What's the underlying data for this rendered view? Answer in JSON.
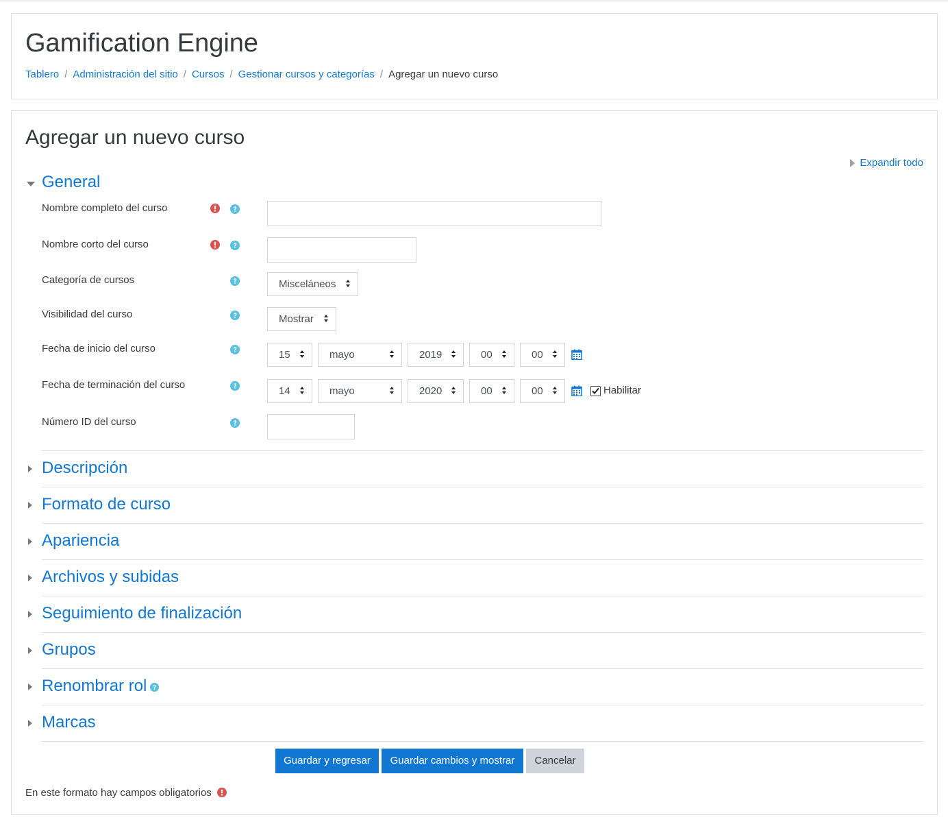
{
  "site": {
    "title": "Gamification Engine"
  },
  "breadcrumb": [
    {
      "label": "Tablero"
    },
    {
      "label": "Administración del sitio"
    },
    {
      "label": "Cursos"
    },
    {
      "label": "Gestionar cursos y categorías"
    },
    {
      "label": "Agregar un nuevo curso"
    }
  ],
  "page": {
    "heading": "Agregar un nuevo curso",
    "expand_all": "Expandir todo"
  },
  "general": {
    "title": "General",
    "fields": {
      "fullname": {
        "label": "Nombre completo del curso",
        "value": ""
      },
      "shortname": {
        "label": "Nombre corto del curso",
        "value": ""
      },
      "category": {
        "label": "Categoría de cursos",
        "value": "Misceláneos"
      },
      "visibility": {
        "label": "Visibilidad del curso",
        "value": "Mostrar"
      },
      "startdate": {
        "label": "Fecha de inicio del curso",
        "day": "15",
        "month": "mayo",
        "year": "2019",
        "hour": "00",
        "minute": "00"
      },
      "enddate": {
        "label": "Fecha de terminación del curso",
        "day": "14",
        "month": "mayo",
        "year": "2020",
        "hour": "00",
        "minute": "00",
        "enable_label": "Habilitar",
        "enabled": true
      },
      "idnumber": {
        "label": "Número ID del curso",
        "value": ""
      }
    }
  },
  "sections": [
    {
      "title": "Descripción"
    },
    {
      "title": "Formato de curso"
    },
    {
      "title": "Apariencia"
    },
    {
      "title": "Archivos y subidas"
    },
    {
      "title": "Seguimiento de finalización"
    },
    {
      "title": "Grupos"
    },
    {
      "title": "Renombrar rol"
    },
    {
      "title": "Marcas"
    }
  ],
  "buttons": {
    "save_return": "Guardar y regresar",
    "save_display": "Guardar cambios y mostrar",
    "cancel": "Cancelar"
  },
  "required_note": "En este formato hay campos obligatorios",
  "colors": {
    "link": "#1177d1",
    "required": "#d9534f",
    "help": "#5bc0de",
    "secondary": "#ced4da"
  },
  "icons": {
    "required": "exclamation-circle-icon",
    "help": "question-circle-icon",
    "calendar": "calendar-icon"
  }
}
